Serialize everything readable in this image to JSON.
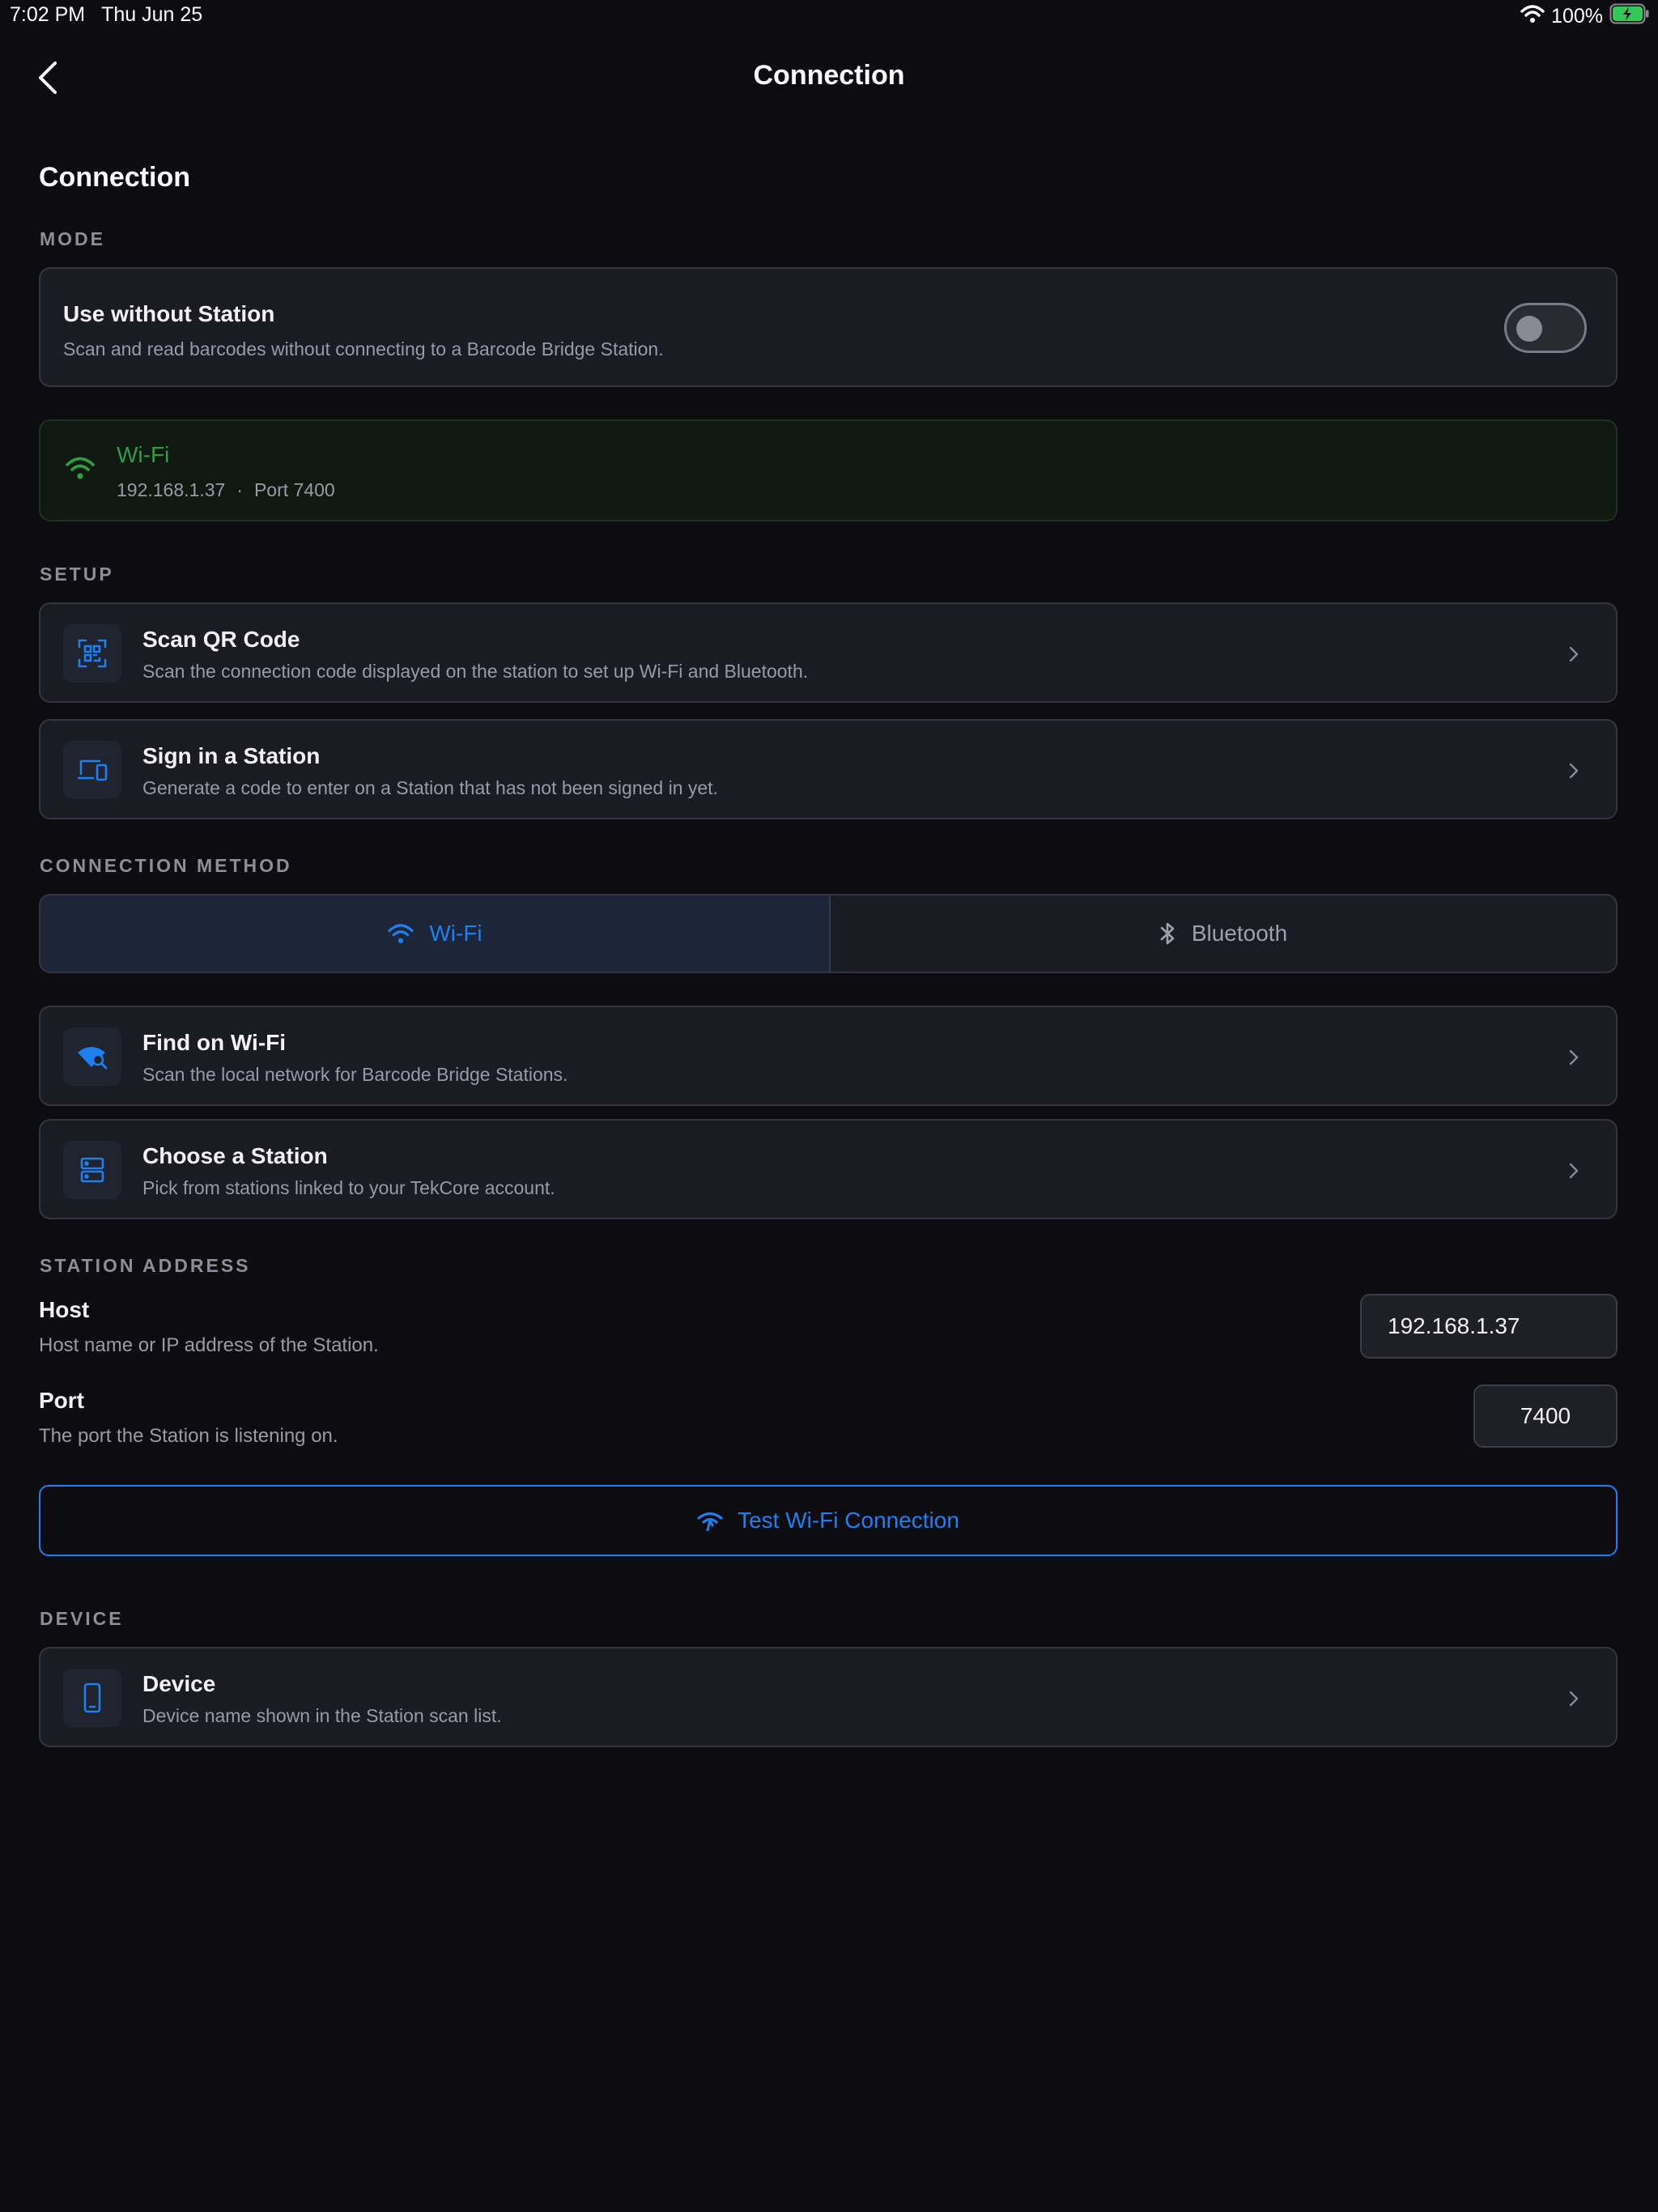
{
  "status_bar": {
    "time": "7:02 PM",
    "date": "Thu Jun 25",
    "battery": "100%"
  },
  "nav": {
    "title": "Connection",
    "back_icon": "chevron-left-icon"
  },
  "page": {
    "heading": "Connection"
  },
  "sections": {
    "mode": "MODE",
    "setup": "SETUP",
    "connection_method": "CONNECTION METHOD",
    "station_address": "STATION ADDRESS",
    "device": "DEVICE"
  },
  "mode": {
    "title": "Use without Station",
    "subtitle": "Scan and read barcodes without connecting to a Barcode Bridge Station.",
    "enabled": false
  },
  "connection_status": {
    "title": "Wi-Fi",
    "host": "192.168.1.37",
    "separator": "·",
    "port_label": "Port 7400",
    "color": "#2e9e44"
  },
  "setup": {
    "items": [
      {
        "title": "Scan QR Code",
        "subtitle": "Scan the connection code displayed on the station to set up Wi-Fi and Bluetooth.",
        "icon": "qr-scan-icon"
      },
      {
        "title": "Sign in a Station",
        "subtitle": "Generate a code to enter on a Station that has not been signed in yet.",
        "icon": "devices-icon"
      }
    ]
  },
  "connection_method": {
    "options": [
      {
        "label": "Wi-Fi",
        "icon": "wifi-icon",
        "selected": true
      },
      {
        "label": "Bluetooth",
        "icon": "bluetooth-icon",
        "selected": false
      }
    ]
  },
  "wifi_actions": {
    "items": [
      {
        "title": "Find on Wi-Fi",
        "subtitle": "Scan the local network for Barcode Bridge Stations.",
        "icon": "wifi-search-icon"
      },
      {
        "title": "Choose a Station",
        "subtitle": "Pick from stations linked to your TekCore account.",
        "icon": "server-icon"
      }
    ]
  },
  "station_address": {
    "host": {
      "label": "Host",
      "description": "Host name or IP address of the Station.",
      "value": "192.168.1.37"
    },
    "port": {
      "label": "Port",
      "description": "The port the Station is listening on.",
      "value": "7400"
    }
  },
  "test_button": {
    "label": "Test Wi-Fi Connection",
    "icon": "signal-icon"
  },
  "device": {
    "title": "Device",
    "subtitle": "Device name shown in the Station scan list.",
    "icon": "phone-icon"
  },
  "colors": {
    "accent": "#1e7ff0",
    "background": "#0c0c11",
    "card": "#1b1b23",
    "success": "#2e9e44",
    "battery": "#35c75a"
  }
}
